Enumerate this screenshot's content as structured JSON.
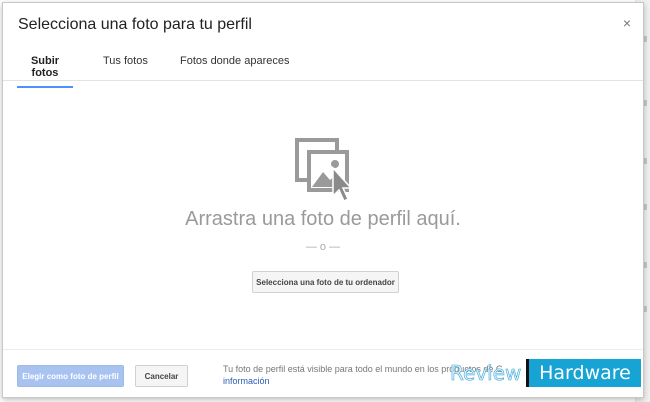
{
  "dialog": {
    "title": "Selecciona una foto para tu perfil",
    "close_icon": "×"
  },
  "tabs": [
    {
      "label": "Subir fotos",
      "active": true
    },
    {
      "label": "Tus fotos",
      "active": false
    },
    {
      "label": "Fotos donde apareces",
      "active": false
    }
  ],
  "dropzone": {
    "icon": "photo-upload-icon",
    "drag_text": "Arrastra una foto de perfil aquí.",
    "or_text": "— o —",
    "select_button_label": "Selecciona una foto de tu ordenador"
  },
  "footer": {
    "set_profile_label": "Elegir como foto de perfil",
    "cancel_label": "Cancelar",
    "notice_text": "Tu foto de perfil está visible para todo el mundo en los productos de G",
    "notice_link": "información"
  },
  "watermark": {
    "part1": "Review",
    "part2": "Hardware"
  },
  "colors": {
    "tab_underline": "#4d90fe",
    "primary_disabled": "#a9c3f1",
    "link": "#2a5db0"
  }
}
